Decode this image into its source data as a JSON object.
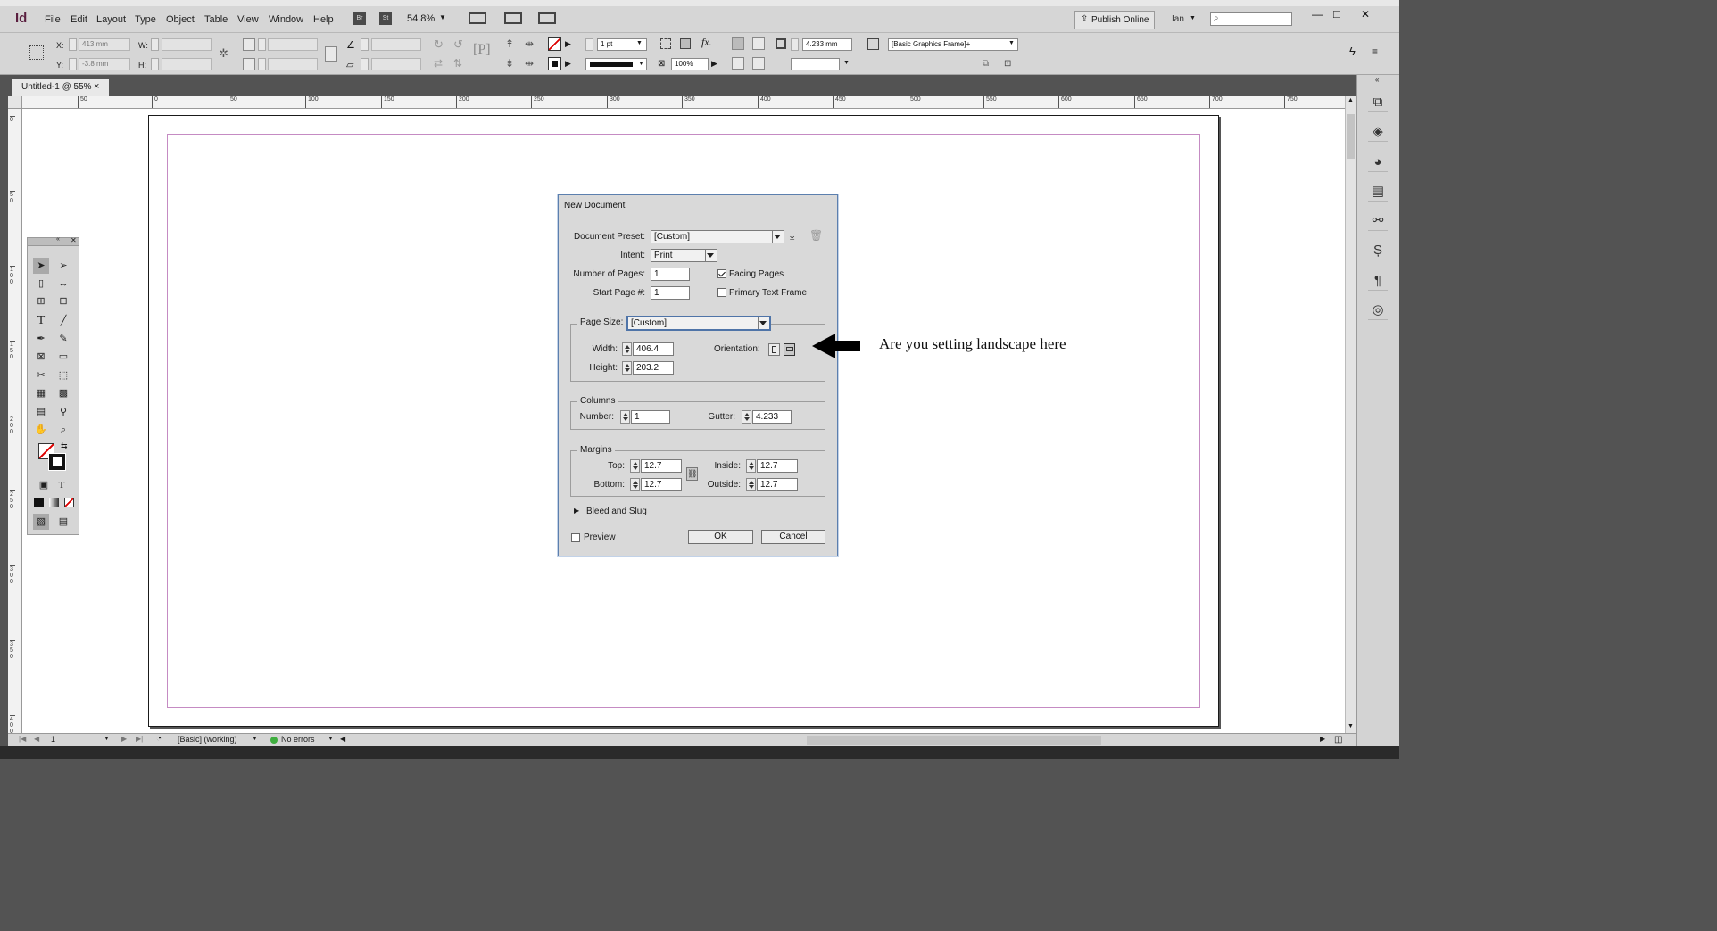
{
  "app": {
    "logo": "Id"
  },
  "menu": [
    "File",
    "Edit",
    "Layout",
    "Type",
    "Object",
    "Table",
    "View",
    "Window",
    "Help"
  ],
  "topbar": {
    "bridge": "Br",
    "stock": "St",
    "zoom": "54.8%",
    "publish": "Publish Online",
    "user": "Ian",
    "window_buttons": [
      "—",
      "□",
      "✕"
    ]
  },
  "control": {
    "x_label": "X:",
    "y_label": "Y:",
    "w_label": "W:",
    "h_label": "H:",
    "x_value": "413 mm",
    "y_value": "-3.8 mm",
    "stroke_weight": "1 pt",
    "opacity": "100%",
    "gutter_value": "4.233 mm",
    "object_style": "[Basic Graphics Frame]+"
  },
  "doc_tab": {
    "title": "Untitled-1 @ 55%",
    "close": "×"
  },
  "ruler": {
    "top": [
      "50",
      "0",
      "50",
      "100",
      "150",
      "200",
      "250",
      "300",
      "350",
      "400",
      "450",
      "500",
      "550",
      "600",
      "650",
      "700",
      "750"
    ],
    "left": [
      "0",
      "5 0",
      "1 0 0",
      "1 5 0",
      "2 0 0",
      "2 5 0",
      "3 0 0",
      "3 5 0",
      "4 0 0"
    ]
  },
  "status": {
    "page": "1",
    "profile": "[Basic] (working)",
    "errors": "No errors"
  },
  "dialog": {
    "title": "New Document",
    "preset_label": "Document Preset:",
    "preset_value": "[Custom]",
    "intent_label": "Intent:",
    "intent_value": "Print",
    "pages_label": "Number of Pages:",
    "pages_value": "1",
    "start_label": "Start Page #:",
    "start_value": "1",
    "facing_label": "Facing Pages",
    "facing_checked": true,
    "primary_label": "Primary Text Frame",
    "primary_checked": false,
    "pagesize_label": "Page Size:",
    "pagesize_value": "[Custom]",
    "width_label": "Width:",
    "width_value": "406.4 mr",
    "height_label": "Height:",
    "height_value": "203.2 mr",
    "orientation_label": "Orientation:",
    "columns_label": "Columns",
    "number_label": "Number:",
    "number_value": "1",
    "gutter_label": "Gutter:",
    "gutter_value": "4.233 mr",
    "margins_label": "Margins",
    "top_label": "Top:",
    "top_value": "12.7 mm",
    "bottom_label": "Bottom:",
    "bottom_value": "12.7 mm",
    "inside_label": "Inside:",
    "inside_value": "12.7 mm",
    "outside_label": "Outside:",
    "outside_value": "12.7 mm",
    "bleed_label": "Bleed and Slug",
    "preview_label": "Preview",
    "ok_label": "OK",
    "cancel_label": "Cancel"
  },
  "annotation": "Are you setting landscape here",
  "colors": {
    "accent": "#5c7fae",
    "margin_guide": "#c58bc3",
    "status_ok": "#3fae3f"
  }
}
